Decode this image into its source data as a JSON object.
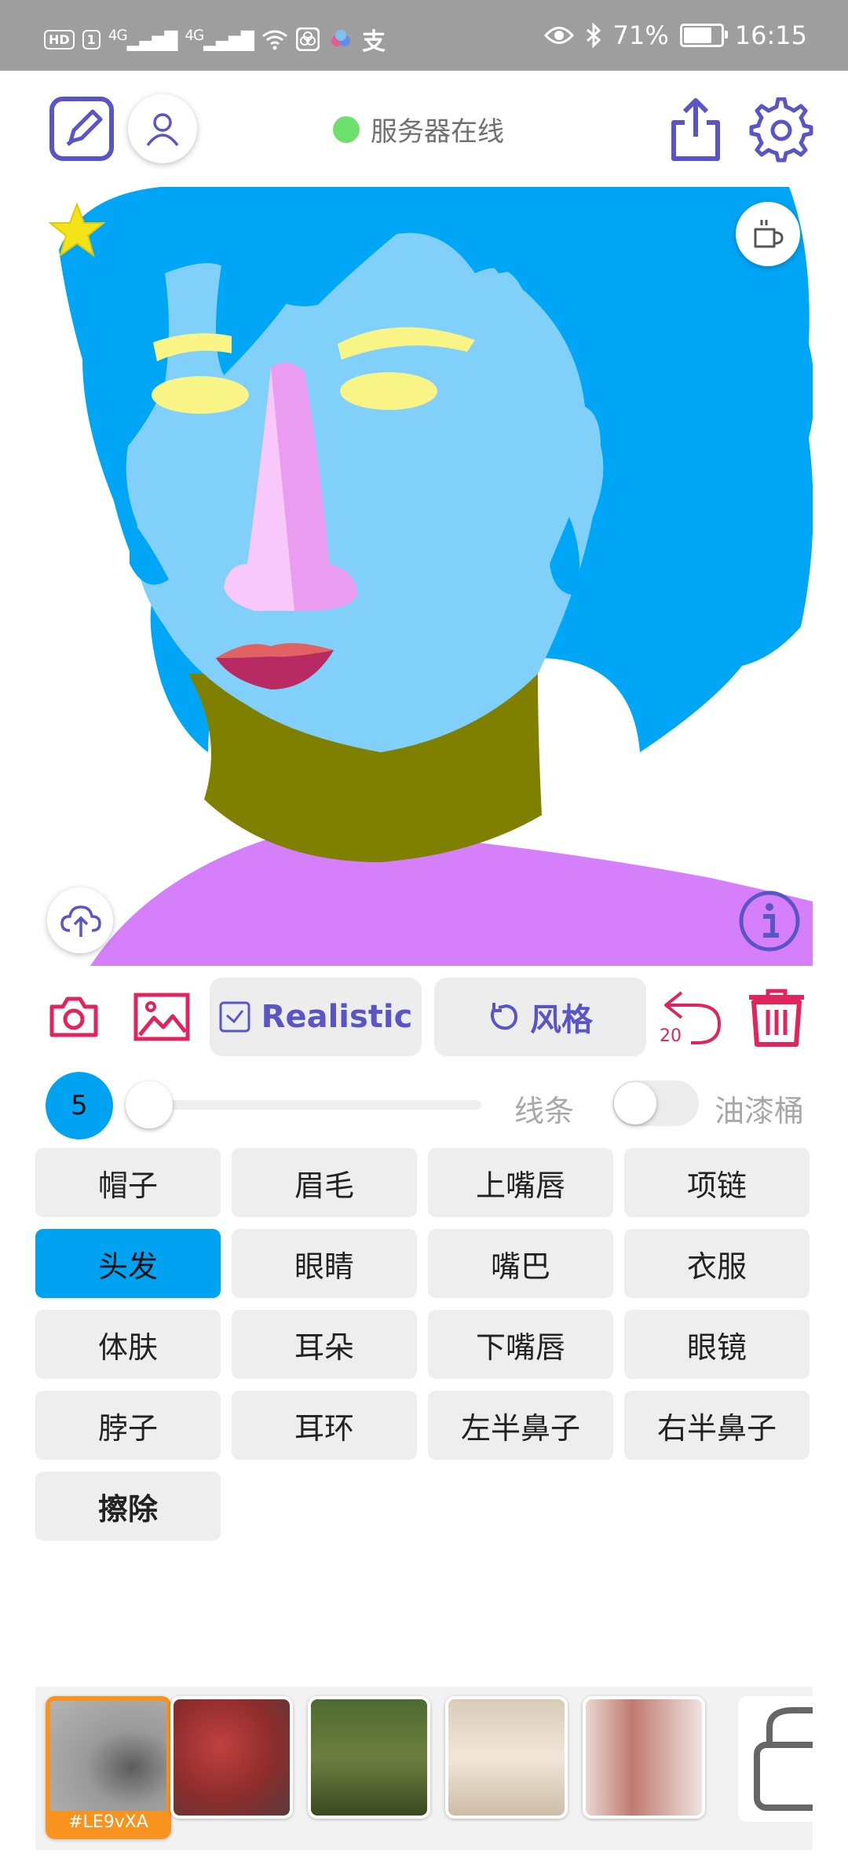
{
  "status_bar": {
    "hd": "HD",
    "sim": "1",
    "signal1": "4G",
    "signal2": "4G",
    "pay_glyph": "支",
    "battery_text": "71%",
    "battery_level": 0.71,
    "time": "16:15"
  },
  "header": {
    "server_status": "服务器在线",
    "server_status_color": "#6fe06f"
  },
  "toolbar": {
    "realistic_label": "Realistic",
    "style_label": "风格",
    "undo_count": "20"
  },
  "brush": {
    "size": "5",
    "size_circle_color": "#00a2f2",
    "line_label": "线条",
    "bucket_label": "油漆桶",
    "bucket_enabled": false
  },
  "parts": {
    "items": [
      {
        "label": "帽子"
      },
      {
        "label": "眉毛"
      },
      {
        "label": "上嘴唇"
      },
      {
        "label": "项链"
      },
      {
        "label": "头发",
        "active": true
      },
      {
        "label": "眼睛"
      },
      {
        "label": "嘴巴"
      },
      {
        "label": "衣服"
      },
      {
        "label": "体肤"
      },
      {
        "label": "耳朵"
      },
      {
        "label": "下嘴唇"
      },
      {
        "label": "眼镜"
      },
      {
        "label": "脖子"
      },
      {
        "label": "耳环"
      },
      {
        "label": "左半鼻子"
      },
      {
        "label": "右半鼻子"
      },
      {
        "label": "擦除",
        "bold": true
      }
    ]
  },
  "gallery": {
    "selected_label": "#LE9vXA"
  },
  "colors": {
    "accent": "#5a55c6",
    "danger": "#e0245e",
    "active": "#00a2f2",
    "hair": "#00a6f6",
    "skin": "#80d0fa",
    "eyes": "#f9f486",
    "neck": "#808000",
    "clothes": "#d580fa"
  }
}
